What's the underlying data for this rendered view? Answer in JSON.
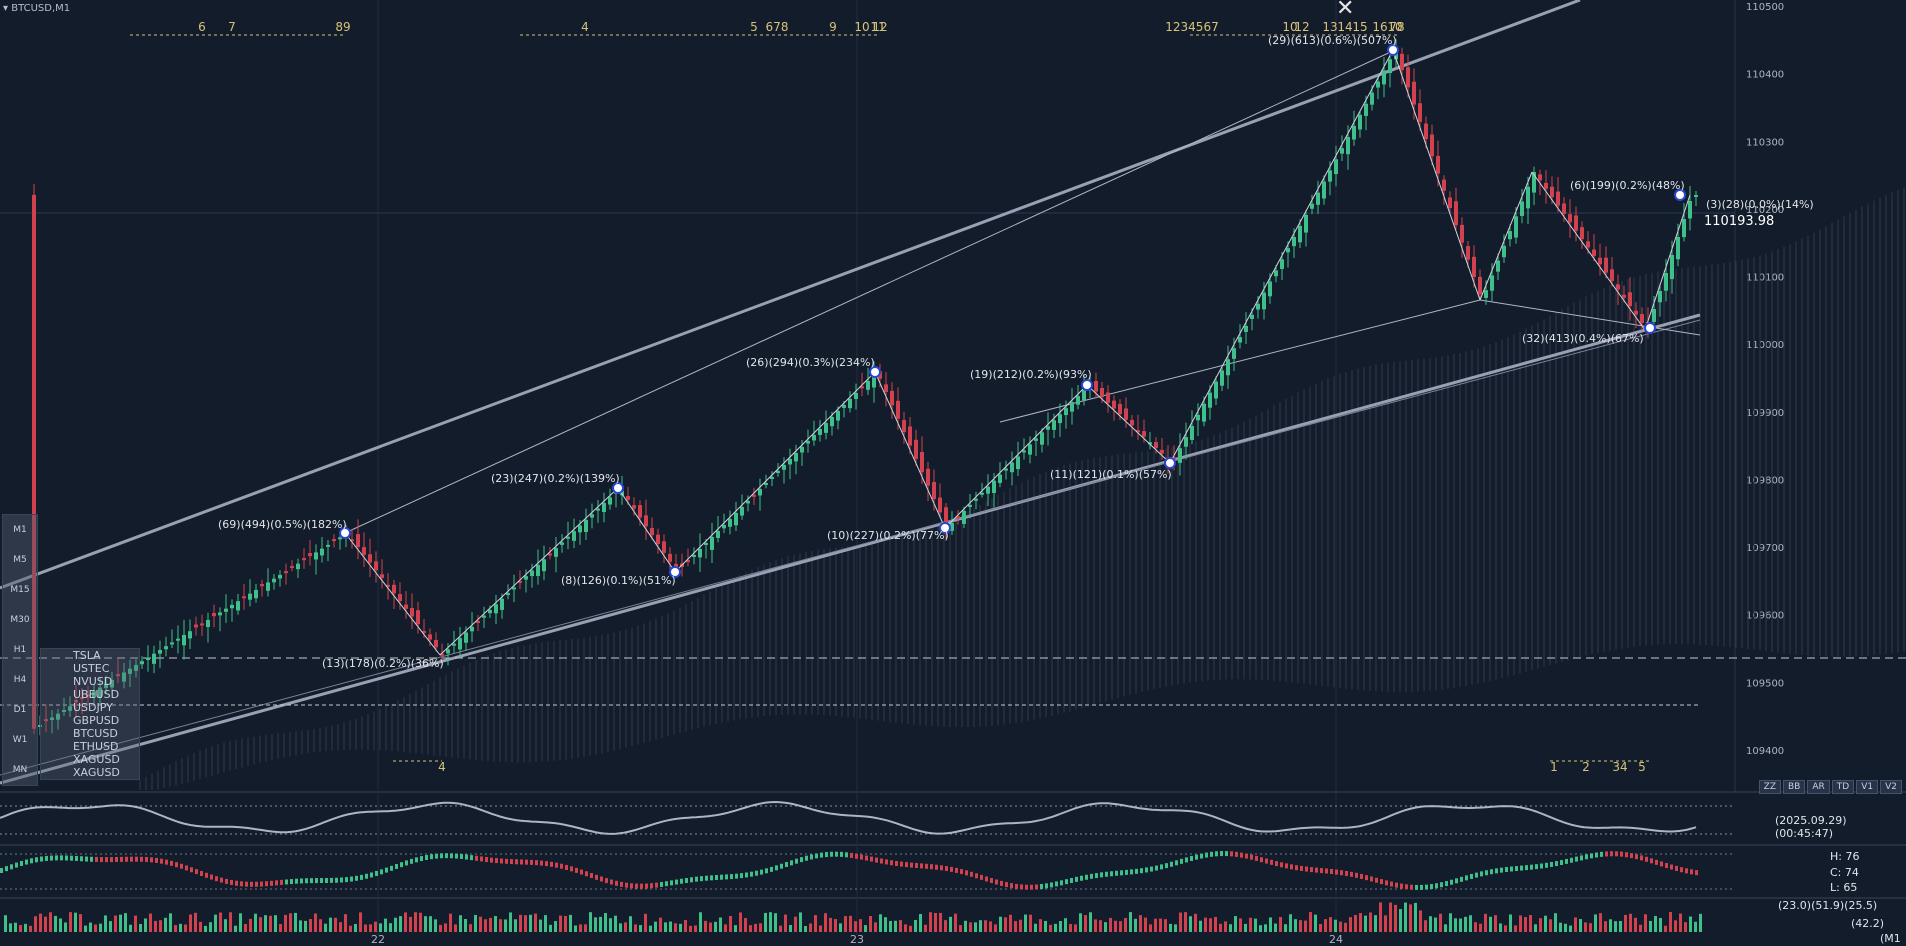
{
  "window": {
    "title": "BTCUSD,M1"
  },
  "close_glyph": "✕",
  "current_price": "110193.98",
  "price_axis": [
    "110500",
    "110400",
    "110300",
    "110200",
    "110100",
    "110000",
    "109900",
    "109800",
    "109700",
    "109600",
    "109500",
    "109400"
  ],
  "date_axis": [
    "22",
    "23",
    "24"
  ],
  "timeframes": [
    "M1",
    "M5",
    "M15",
    "M30",
    "H1",
    "H4",
    "D1",
    "W1",
    "MN"
  ],
  "symbols": [
    "TSLA",
    "USTEC",
    "NVUSD",
    "UBEUSD",
    "USDJPY",
    "GBPUSD",
    "BTCUSD",
    "ETHUSD",
    "XAGUSD",
    "XAGUSD"
  ],
  "buttons": [
    "ZZ",
    "BB",
    "AR",
    "TD",
    "V1",
    "V2"
  ],
  "annotations": [
    "(69)(494)(0.5%)(182%)",
    "(13)(178)(0.2%)(36%)",
    "(23)(247)(0.2%)(139%)",
    "(8)(126)(0.1%)(51%)",
    "(26)(294)(0.3%)(234%)",
    "(10)(227)(0.2%)(77%)",
    "(19)(212)(0.2%)(93%)",
    "(11)(121)(0.1%)(57%)",
    "(29)(613)(0.6%)(507%)",
    "(6)(199)(0.2%)(48%)",
    "(3)(28)(0.0%)(14%)",
    "(32)(413)(0.4%)(67%)"
  ],
  "top_counts": [
    "6",
    "7",
    "89",
    "4",
    "5",
    "678",
    "9",
    "10",
    "11",
    "12",
    "1234567",
    "10",
    "12",
    "13",
    "14",
    "15",
    "16",
    "78",
    "10"
  ],
  "bottom_counts": [
    "4",
    "1",
    "2",
    "34",
    "5"
  ],
  "info": {
    "datetime": "(2025.09.29) (00:45:47)",
    "h": "H:  76",
    "c": "C:  74",
    "l": "L:   65",
    "vol1": "(23.0)(51.9)(25.5)",
    "vol2": "(42.2)",
    "corner": "(M1"
  },
  "colors": {
    "background": "#131c2b",
    "up": "#3fbf8a",
    "down": "#d2424e",
    "count": "#d6c27a",
    "line": "#9aa0b4"
  }
}
